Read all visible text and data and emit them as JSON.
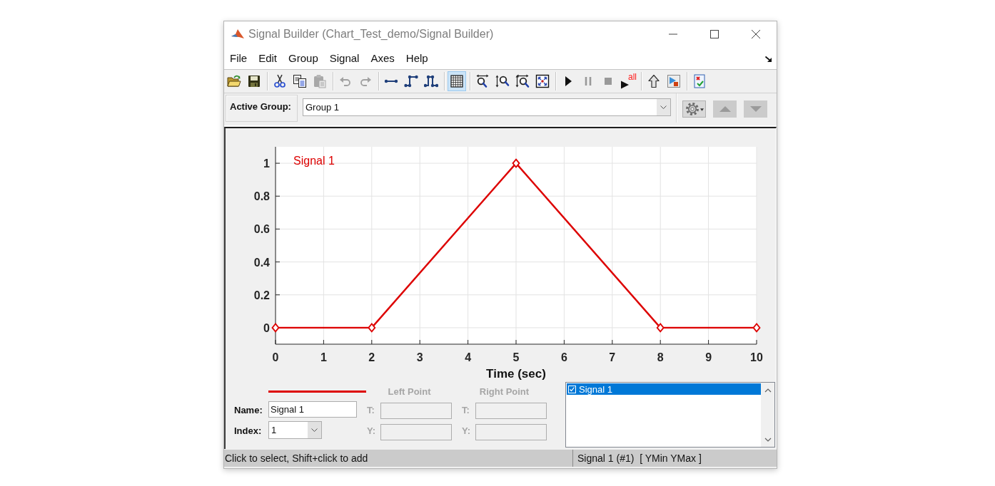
{
  "window": {
    "title": "Signal Builder (Chart_Test_demo/Signal Builder)"
  },
  "menu": [
    "File",
    "Edit",
    "Group",
    "Signal",
    "Axes",
    "Help"
  ],
  "toolbar": [
    [
      {
        "kind": "open",
        "disabled": false,
        "pressed": false
      },
      {
        "kind": "save",
        "disabled": false,
        "pressed": false
      }
    ],
    [
      {
        "kind": "cut",
        "disabled": false,
        "pressed": false
      },
      {
        "kind": "copy",
        "disabled": false,
        "pressed": false
      },
      {
        "kind": "paste",
        "disabled": true,
        "pressed": false
      }
    ],
    [
      {
        "kind": "undo",
        "disabled": true,
        "pressed": false
      },
      {
        "kind": "redo",
        "disabled": true,
        "pressed": false
      }
    ],
    [
      {
        "kind": "line",
        "disabled": false,
        "pressed": false
      },
      {
        "kind": "step",
        "disabled": false,
        "pressed": false
      },
      {
        "kind": "pulse",
        "disabled": false,
        "pressed": false
      }
    ],
    [
      {
        "kind": "grid",
        "disabled": false,
        "pressed": true
      }
    ],
    [
      {
        "kind": "zoomx",
        "disabled": false,
        "pressed": false
      },
      {
        "kind": "zoomy",
        "disabled": false,
        "pressed": false
      },
      {
        "kind": "zoomxy",
        "disabled": false,
        "pressed": false
      },
      {
        "kind": "fit",
        "disabled": false,
        "pressed": false
      }
    ],
    [
      {
        "kind": "play",
        "disabled": false,
        "pressed": false
      },
      {
        "kind": "pause",
        "disabled": true,
        "pressed": false
      },
      {
        "kind": "stop",
        "disabled": true,
        "pressed": false
      },
      {
        "kind": "playall",
        "label": "all",
        "disabled": false,
        "pressed": false
      }
    ],
    [
      {
        "kind": "up",
        "disabled": false,
        "pressed": false
      },
      {
        "kind": "model",
        "disabled": false,
        "pressed": false
      }
    ],
    [
      {
        "kind": "verify",
        "disabled": false,
        "pressed": false
      }
    ]
  ],
  "group_bar": {
    "label": "Active Group:",
    "value": "Group 1",
    "buttons": [
      {
        "kind": "settings",
        "disabled": false
      },
      {
        "kind": "moveup",
        "disabled": true
      },
      {
        "kind": "movedown",
        "disabled": true
      }
    ]
  },
  "chart": {
    "chart_data": {
      "type": "line",
      "xlabel": "Time (sec)",
      "x": [
        0,
        2,
        5,
        8,
        10
      ],
      "series": [
        {
          "name": "Signal 1",
          "color": "#dd0000",
          "marker": "diamond",
          "values": [
            0,
            0,
            1,
            0,
            0
          ]
        }
      ],
      "xlim": [
        0,
        10
      ],
      "ylim": [
        -0.1,
        1.1
      ],
      "xticks": [
        0,
        1,
        2,
        3,
        4,
        5,
        6,
        7,
        8,
        9,
        10
      ],
      "yticks": [
        0,
        0.2,
        0.4,
        0.6,
        0.8,
        1
      ],
      "grid": true
    }
  },
  "signal_editor": {
    "name_label": "Name:",
    "name_value": "Signal 1",
    "index_label": "Index:",
    "index_value": "1",
    "points": [
      {
        "title": "Left Point",
        "t_label": "T:",
        "y_label": "Y:",
        "disabled": true
      },
      {
        "title": "Right Point",
        "t_label": "T:",
        "y_label": "Y:",
        "disabled": true
      }
    ]
  },
  "signal_list": {
    "items": [
      {
        "label": "Signal 1",
        "checked": true,
        "selected": true
      }
    ]
  },
  "status_bar": {
    "message": "Click to select, Shift+click to add",
    "signal_info": "Signal 1 (#1)  [ YMin YMax ]"
  }
}
